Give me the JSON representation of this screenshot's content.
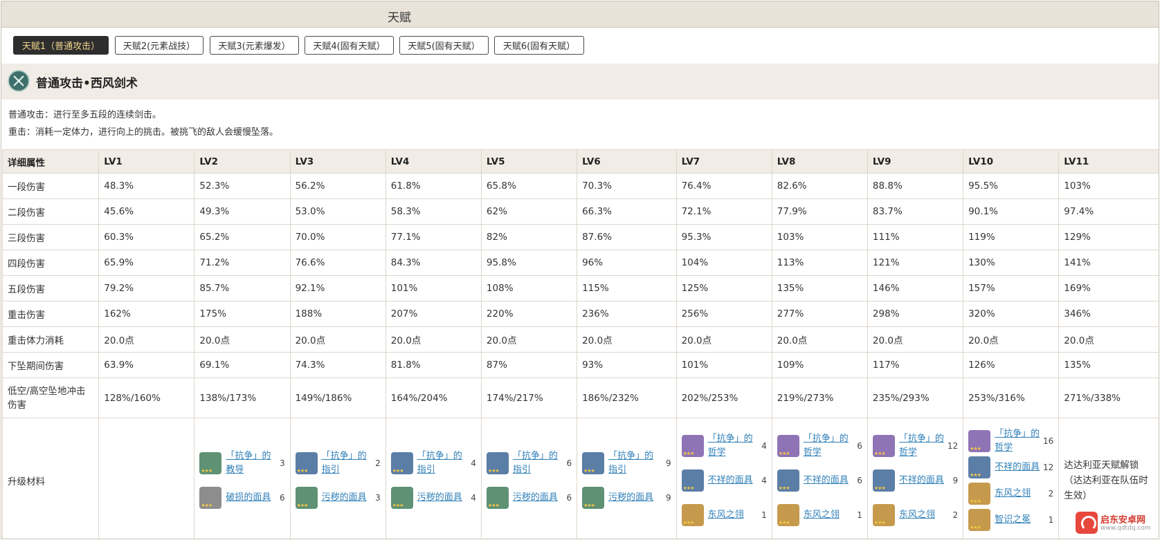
{
  "window": {
    "title": "天赋"
  },
  "tabs": [
    {
      "label": "天赋1（普通攻击）",
      "active": true
    },
    {
      "label": "天赋2(元素战技）",
      "active": false
    },
    {
      "label": "天赋3(元素爆发）",
      "active": false
    },
    {
      "label": "天赋4(固有天赋）",
      "active": false
    },
    {
      "label": "天赋5(固有天赋）",
      "active": false
    },
    {
      "label": "天赋6(固有天赋）",
      "active": false
    }
  ],
  "skill": {
    "icon": "crossed-swords-icon",
    "title": "普通攻击•西风剑术",
    "desc": [
      "普通攻击：进行至多五段的连续剑击。",
      "重击：消耗一定体力，进行向上的挑击。被挑飞的敌人会缓慢坠落。"
    ]
  },
  "table": {
    "headers": [
      "详细属性",
      "LV1",
      "LV2",
      "LV3",
      "LV4",
      "LV5",
      "LV6",
      "LV7",
      "LV8",
      "LV9",
      "LV10",
      "LV11"
    ],
    "rows": [
      {
        "label": "一段伤害",
        "values": [
          "48.3%",
          "52.3%",
          "56.2%",
          "61.8%",
          "65.8%",
          "70.3%",
          "76.4%",
          "82.6%",
          "88.8%",
          "95.5%",
          "103%"
        ]
      },
      {
        "label": "二段伤害",
        "values": [
          "45.6%",
          "49.3%",
          "53.0%",
          "58.3%",
          "62%",
          "66.3%",
          "72.1%",
          "77.9%",
          "83.7%",
          "90.1%",
          "97.4%"
        ]
      },
      {
        "label": "三段伤害",
        "values": [
          "60.3%",
          "65.2%",
          "70.0%",
          "77.1%",
          "82%",
          "87.6%",
          "95.3%",
          "103%",
          "111%",
          "119%",
          "129%"
        ]
      },
      {
        "label": "四段伤害",
        "values": [
          "65.9%",
          "71.2%",
          "76.6%",
          "84.3%",
          "95.8%",
          "96%",
          "104%",
          "113%",
          "121%",
          "130%",
          "141%"
        ]
      },
      {
        "label": "五段伤害",
        "values": [
          "79.2%",
          "85.7%",
          "92.1%",
          "101%",
          "108%",
          "115%",
          "125%",
          "135%",
          "146%",
          "157%",
          "169%"
        ]
      },
      {
        "label": "重击伤害",
        "values": [
          "162%",
          "175%",
          "188%",
          "207%",
          "220%",
          "236%",
          "256%",
          "277%",
          "298%",
          "320%",
          "346%"
        ]
      },
      {
        "label": "重击体力消耗",
        "values": [
          "20.0点",
          "20.0点",
          "20.0点",
          "20.0点",
          "20.0点",
          "20.0点",
          "20.0点",
          "20.0点",
          "20.0点",
          "20.0点",
          "20.0点"
        ]
      },
      {
        "label": "下坠期间伤害",
        "values": [
          "63.9%",
          "69.1%",
          "74.3%",
          "81.8%",
          "87%",
          "93%",
          "101%",
          "109%",
          "117%",
          "126%",
          "135%"
        ]
      },
      {
        "label": "低空/高空坠地冲击伤害",
        "values": [
          "128%/160%",
          "138%/173%",
          "149%/186%",
          "164%/204%",
          "174%/217%",
          "186%/232%",
          "202%/253%",
          "219%/273%",
          "235%/293%",
          "253%/316%",
          "271%/338%"
        ]
      }
    ],
    "materials_label": "升级材料",
    "materials": [
      [],
      [
        {
          "name": "「抗争」的教导",
          "count": "3",
          "icon": "book-icon",
          "color": "green"
        },
        {
          "name": "破损的面具",
          "count": "6",
          "icon": "mask-icon",
          "color": "gray"
        }
      ],
      [
        {
          "name": "「抗争」的指引",
          "count": "2",
          "icon": "book-icon",
          "color": "blue"
        },
        {
          "name": "污秽的面具",
          "count": "3",
          "icon": "mask-icon",
          "color": "green"
        }
      ],
      [
        {
          "name": "「抗争」的指引",
          "count": "4",
          "icon": "book-icon",
          "color": "blue"
        },
        {
          "name": "污秽的面具",
          "count": "4",
          "icon": "mask-icon",
          "color": "green"
        }
      ],
      [
        {
          "name": "「抗争」的指引",
          "count": "6",
          "icon": "book-icon",
          "color": "blue"
        },
        {
          "name": "污秽的面具",
          "count": "6",
          "icon": "mask-icon",
          "color": "green"
        }
      ],
      [
        {
          "name": "「抗争」的指引",
          "count": "9",
          "icon": "book-icon",
          "color": "blue"
        },
        {
          "name": "污秽的面具",
          "count": "9",
          "icon": "mask-icon",
          "color": "green"
        }
      ],
      [
        {
          "name": "「抗争」的哲学",
          "count": "4",
          "icon": "book-icon",
          "color": "purple"
        },
        {
          "name": "不祥的面具",
          "count": "4",
          "icon": "mask-icon",
          "color": "blue"
        },
        {
          "name": "东风之翎",
          "count": "1",
          "icon": "feather-icon",
          "color": "gold"
        }
      ],
      [
        {
          "name": "「抗争」的哲学",
          "count": "6",
          "icon": "book-icon",
          "color": "purple"
        },
        {
          "name": "不祥的面具",
          "count": "6",
          "icon": "mask-icon",
          "color": "blue"
        },
        {
          "name": "东风之翎",
          "count": "1",
          "icon": "feather-icon",
          "color": "gold"
        }
      ],
      [
        {
          "name": "「抗争」的哲学",
          "count": "12",
          "icon": "book-icon",
          "color": "purple"
        },
        {
          "name": "不祥的面具",
          "count": "9",
          "icon": "mask-icon",
          "color": "blue"
        },
        {
          "name": "东风之翎",
          "count": "2",
          "icon": "feather-icon",
          "color": "gold"
        }
      ],
      [
        {
          "name": "「抗争」的哲学",
          "count": "16",
          "icon": "book-icon",
          "color": "purple"
        },
        {
          "name": "不祥的面具",
          "count": "12",
          "icon": "mask-icon",
          "color": "blue"
        },
        {
          "name": "东风之翎",
          "count": "2",
          "icon": "feather-icon",
          "color": "gold"
        },
        {
          "name": "智识之冕",
          "count": "1",
          "icon": "crown-icon",
          "color": "gold"
        }
      ]
    ],
    "unlock_note": "达达利亚天赋解锁（达达利亚在队伍时生效）"
  },
  "watermark": {
    "text": "启东安卓网",
    "url": "www.qdtdq.com"
  },
  "colors": {
    "tab_active_bg": "#2e2e2e",
    "tab_active_text": "#f1d58c",
    "link": "#2f7fb8",
    "header_bg": "#f1ede6"
  }
}
